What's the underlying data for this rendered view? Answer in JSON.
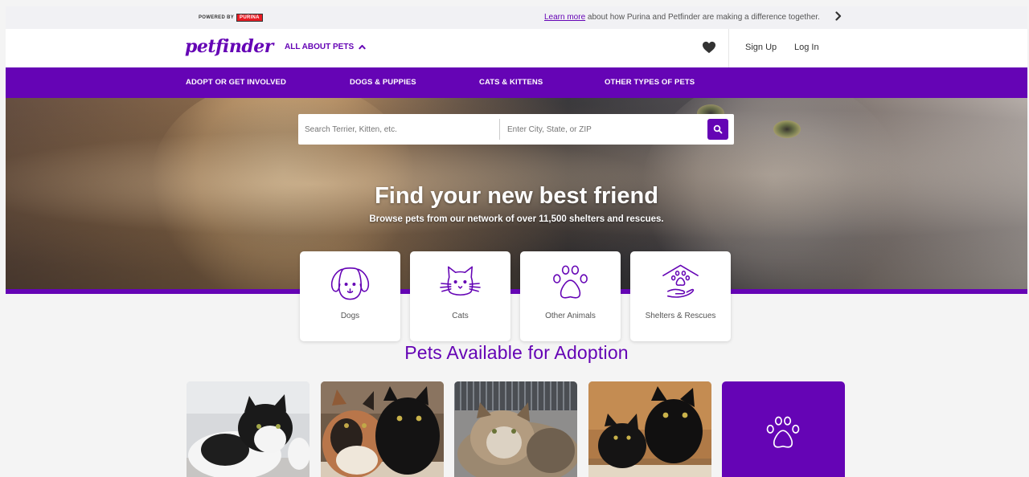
{
  "promo_bar": {
    "powered_by": "POWERED BY",
    "purina": "PURINA",
    "link_text": "Learn more",
    "message": " about how Purina and Petfinder are making a difference together."
  },
  "header": {
    "logo": "petfinder",
    "all_about_pets": "ALL ABOUT PETS",
    "sign_up": "Sign Up",
    "log_in": "Log In"
  },
  "nav": {
    "items": [
      {
        "label": "ADOPT OR GET INVOLVED"
      },
      {
        "label": "DOGS & PUPPIES"
      },
      {
        "label": "CATS & KITTENS"
      },
      {
        "label": "OTHER TYPES OF PETS"
      }
    ]
  },
  "search": {
    "pet_placeholder": "Search Terrier, Kitten, etc.",
    "location_placeholder": "Enter City, State, or ZIP"
  },
  "hero": {
    "title": "Find your new best friend",
    "subtitle": "Browse pets from our network of over 11,500 shelters and rescues."
  },
  "categories": [
    {
      "label": "Dogs",
      "icon": "dog-icon"
    },
    {
      "label": "Cats",
      "icon": "cat-icon"
    },
    {
      "label": "Other Animals",
      "icon": "paw-icon"
    },
    {
      "label": "Shelters & Rescues",
      "icon": "shelter-icon"
    }
  ],
  "pets_section": {
    "title": "Pets Available for Adoption"
  },
  "colors": {
    "brand_purple": "#6504b5",
    "nav_text": "#ffffff",
    "background": "#f4f4f4"
  }
}
